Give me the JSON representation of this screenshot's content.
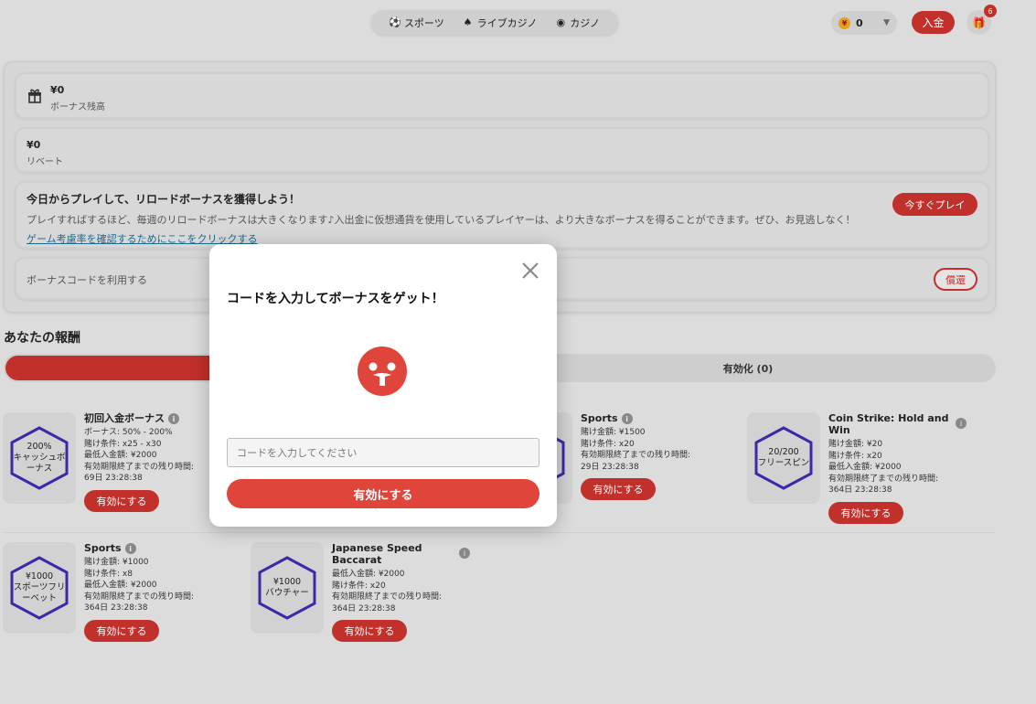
{
  "nav": {
    "items": [
      {
        "label": "スポーツ",
        "icon": "soccer-ball-icon"
      },
      {
        "label": "ライブカジノ",
        "icon": "live-dealer-icon"
      },
      {
        "label": "カジノ",
        "icon": "casino-icon"
      }
    ]
  },
  "wallet": {
    "currency_symbol": "¥",
    "balance": "0"
  },
  "header": {
    "deposit_label": "入金",
    "notification_count": "6"
  },
  "bonus_balance": {
    "amount": "¥0",
    "label": "ボーナス残高"
  },
  "rebate": {
    "amount": "¥0",
    "label": "リベート"
  },
  "promo": {
    "title": "今日からプレイして、リロードボーナスを獲得しよう！",
    "text": "プレイすればするほど、毎週のリロードボーナスは大きくなります♪入出金に仮想通貨を使用しているプレイヤーは、より大きなボーナスを得ることができます。ぜひ、お見逃しなく！",
    "link": "ゲーム考慮率を確認するためにここをクリックする",
    "play_label": "今すぐプレイ"
  },
  "bonus_code": {
    "label": "ボーナスコードを利用する",
    "redeem_label": "償還"
  },
  "rewards": {
    "section_title": "あなたの報酬",
    "tab_active_label": "有効化 (0)",
    "activate_label": "有効にする",
    "items": [
      {
        "badge": "200%\nキャッシュボーナス",
        "title": "初回入金ボーナス",
        "lines": [
          "ボーナス:  50% - 200%",
          "賭け条件:  x25 - x30",
          "最低入金額:  ¥2000",
          "有効期限終了までの残り時間:",
          "69日  23:28:38"
        ]
      },
      {
        "badge": "",
        "title": "Sports",
        "lines": [
          "賭け金額:  ¥1500",
          "賭け条件:  x20",
          "有効期限終了までの残り時間:",
          "29日  23:28:38"
        ]
      },
      {
        "badge": "20/200\nフリースピン",
        "title": "Coin Strike: Hold and Win",
        "lines": [
          "賭け金額:  ¥20",
          "賭け条件:  x20",
          "最低入金額:  ¥2000",
          "有効期限終了までの残り時間:",
          "364日  23:28:38"
        ]
      },
      {
        "badge": "¥1000\nスポーツフリーベット",
        "title": "Sports",
        "lines": [
          "賭け金額:  ¥1000",
          "賭け条件:  x8",
          "最低入金額:  ¥2000",
          "有効期限終了までの残り時間:",
          "364日  23:28:38"
        ]
      },
      {
        "badge": "¥1000\nバウチャー",
        "title": "Japanese Speed Baccarat",
        "lines": [
          "最低入金額:  ¥2000",
          "賭け条件:  x20",
          "有効期限終了までの残り時間:",
          "364日  23:28:38"
        ]
      }
    ]
  },
  "modal": {
    "title": "コードを入力してボーナスをゲット！",
    "input_placeholder": "コードを入力してください",
    "submit_label": "有効にする"
  },
  "colors": {
    "accent": "#c1302a",
    "modal_button": "#e0453b",
    "hex_stroke": "#3b2aa8"
  }
}
